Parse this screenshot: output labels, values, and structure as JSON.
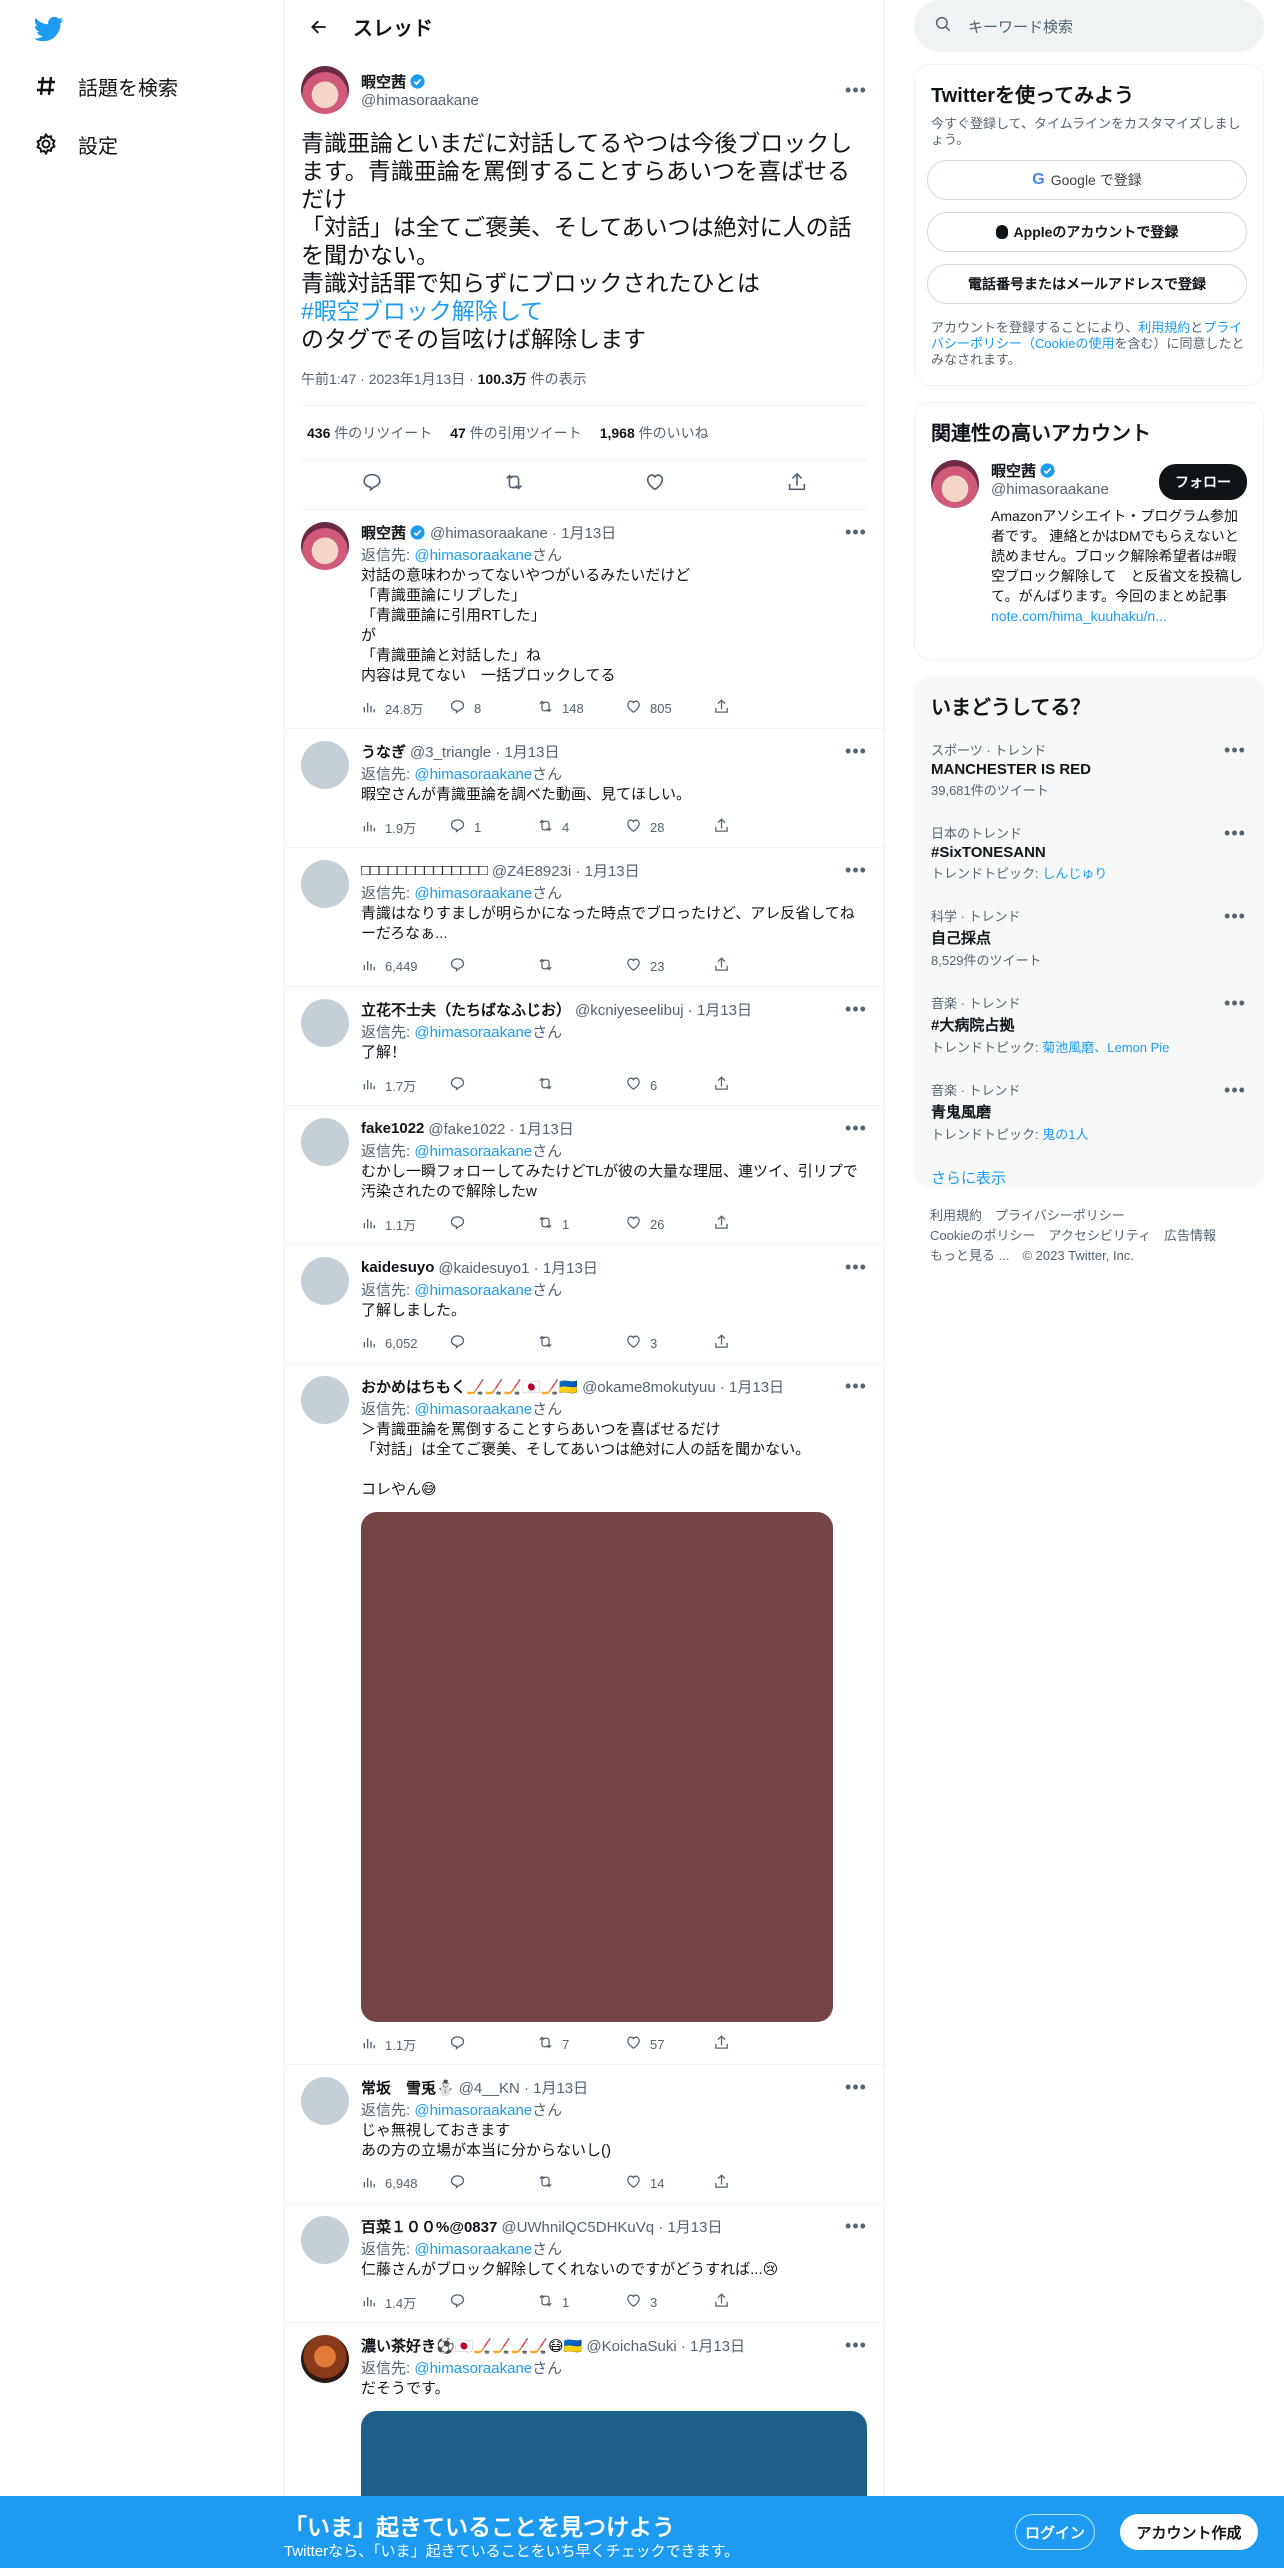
{
  "nav": {
    "explore": "話題を検索",
    "settings": "設定"
  },
  "header": {
    "title": "スレッド"
  },
  "tweet": {
    "name": "暇空茜",
    "handle": "@himasoraakane",
    "body_before": "青識亜論といまだに対話してるやつは今後ブロックします。青識亜論を罵倒することすらあいつを喜ばせるだけ\n「対話」は全てご褒美、そしてあいつは絶対に人の話を聞かない。\n青識対話罪で知らずにブロックされたひとは\n",
    "hashtag": "#暇空ブロック解除して",
    "body_after": "\nのタグでその旨呟けば解除します",
    "time": "午前1:47 · 2023年1月13日 · ",
    "views": "100.3万",
    "views_label": " 件の表示",
    "retweets": "436",
    "retweets_label": " 件のリツイート",
    "quotes": "47",
    "quotes_label": " 件の引用ツイート",
    "likes": "1,968",
    "likes_label": " 件のいいね"
  },
  "replying_prefix": "返信先: ",
  "replying_handle": "@himasoraakane",
  "replying_suffix": "さん",
  "replies": [
    {
      "name": "暇空茜",
      "handle": "@himasoraakane · 1月13日",
      "text": "対話の意味わかってないやつがいるみたいだけど\n「青識亜論にリプした」\n「青識亜論に引用RTした」\nが\n「青識亜論と対話した」ね\n内容は見てない　一括ブロックしてる",
      "views": "24.8万",
      "replies": "8",
      "rts": "148",
      "likes": "805"
    },
    {
      "name": "うなぎ",
      "handle": "@3_triangle · 1月13日",
      "text": "暇空さんが青識亜論を調べた動画、見てほしい。",
      "views": "1.9万",
      "replies": "1",
      "rts": "4",
      "likes": "28"
    },
    {
      "name": "□□□□□□□□□□□□□□",
      "handle": "@Z4E8923i · 1月13日",
      "text": "青識はなりすましが明らかになった時点でブロったけど、アレ反省してねーだろなぁ...",
      "views": "6,449",
      "replies": "",
      "rts": "",
      "likes": "23"
    },
    {
      "name": "立花不士夫（たちばなふじお）",
      "handle": "@kcniyeseelibuj · 1月13日",
      "text": "了解！",
      "views": "1.7万",
      "replies": "",
      "rts": "",
      "likes": "6"
    },
    {
      "name": "fake1022",
      "handle": "@fake1022 · 1月13日",
      "text": "むかし一瞬フォローしてみたけどTLが彼の大量な理屈、連ツイ、引リプで汚染されたので解除したw",
      "views": "1.1万",
      "replies": "",
      "rts": "1",
      "likes": "26"
    },
    {
      "name": "kaidesuyo",
      "handle": "@kaidesuyo1 · 1月13日",
      "text": "了解しました。",
      "views": "6,052",
      "replies": "",
      "rts": "",
      "likes": "3"
    },
    {
      "name": "おかめはちもく🏒🏒🏒🇯🇵🏒🇺🇦",
      "handle": "@okame8mokutyuu · 1月13日",
      "text": "＞青識亜論を罵倒することすらあいつを喜ばせるだけ\n「対話」は全てご褒美、そしてあいつは絶対に人の話を聞かない。\n\nコレやん😅",
      "views": "1.1万",
      "replies": "",
      "rts": "7",
      "likes": "57"
    },
    {
      "name": "常坂　雪兎⛄",
      "handle": "@4__KN · 1月13日",
      "text": "じゃ無視しておきます\nあの方の立場が本当に分からないし()",
      "views": "6,948",
      "replies": "",
      "rts": "",
      "likes": "14"
    },
    {
      "name": "百菜１００%@0837",
      "handle": "@UWhnilQC5DHKuVq · 1月13日",
      "text": "仁藤さんがブロック解除してくれないのですがどうすれば...😢",
      "views": "1.4万",
      "replies": "",
      "rts": "1",
      "likes": "3"
    },
    {
      "name": "濃い茶好き⚽🇯🇵🏒🏒🏒🏒😷🇺🇦",
      "handle": "@KoichaSuki · 1月13日",
      "text": "だそうです。",
      "views": "",
      "replies": "",
      "rts": "",
      "likes": ""
    }
  ],
  "search": {
    "placeholder": "キーワード検索"
  },
  "signup": {
    "title": "Twitterを使ってみよう",
    "subtitle": "今すぐ登録して、タイムラインをカスタマイズしましょう。",
    "google": "Google で登録",
    "apple": "Appleのアカウントで登録",
    "phone": "電話番号またはメールアドレスで登録",
    "terms_1": "アカウントを登録することにより、",
    "terms_link1": "利用規約",
    "terms_2": "と",
    "terms_link2": "プライバシーポリシー（Cookieの使用",
    "terms_3": "を含む）に同意したとみなされます。"
  },
  "related": {
    "title": "関連性の高いアカウント",
    "name": "暇空茜",
    "handle": "@himasoraakane",
    "follow": "フォロー",
    "bio": "Amazonアソシエイト・プログラム参加者です。 連絡とかはDMでもらえないと読めません。ブロック解除希望者は#暇空ブロック解除して　と反省文を投稿して。がんばります。今回のまとめ記事",
    "bio_link": "note.com/hima_kuuhaku/n..."
  },
  "trends": {
    "title": "いまどうしてる？",
    "items": [
      {
        "ctx": "スポーツ · トレンド",
        "name": "MANCHESTER IS RED",
        "sub": "39,681件のツイート",
        "link": ""
      },
      {
        "ctx": "日本のトレンド",
        "name": "#SixTONESANN",
        "sub": "トレンドトピック: ",
        "link": "しんじゅり"
      },
      {
        "ctx": "科学 · トレンド",
        "name": "自己採点",
        "sub": "8,529件のツイート",
        "link": ""
      },
      {
        "ctx": "音楽 · トレンド",
        "name": "#大病院占拠",
        "sub": "トレンドトピック: ",
        "link": "菊池風磨、Lemon Pie"
      },
      {
        "ctx": "音楽 · トレンド",
        "name": "青鬼風磨",
        "sub": "トレンドトピック: ",
        "link": "鬼の1人"
      }
    ],
    "show_more": "さらに表示"
  },
  "footer": {
    "line1": "利用規約　プライバシーポリシー",
    "line2": "Cookieのポリシー　アクセシビリティ　広告情報",
    "line3": "もっと見る ...　© 2023 Twitter, Inc."
  },
  "bottom_bar": {
    "title": "「いま」起きていることを見つけよう",
    "subtitle": "Twitterなら、「いま」起きていることをいち早くチェックできます。",
    "login": "ログイン",
    "signup": "アカウント作成"
  },
  "colors": {
    "brand": "#1d9bf0",
    "text": "#0f1419",
    "secondary": "#536471",
    "media1": "#754446",
    "media2": "#1d5f8a"
  }
}
